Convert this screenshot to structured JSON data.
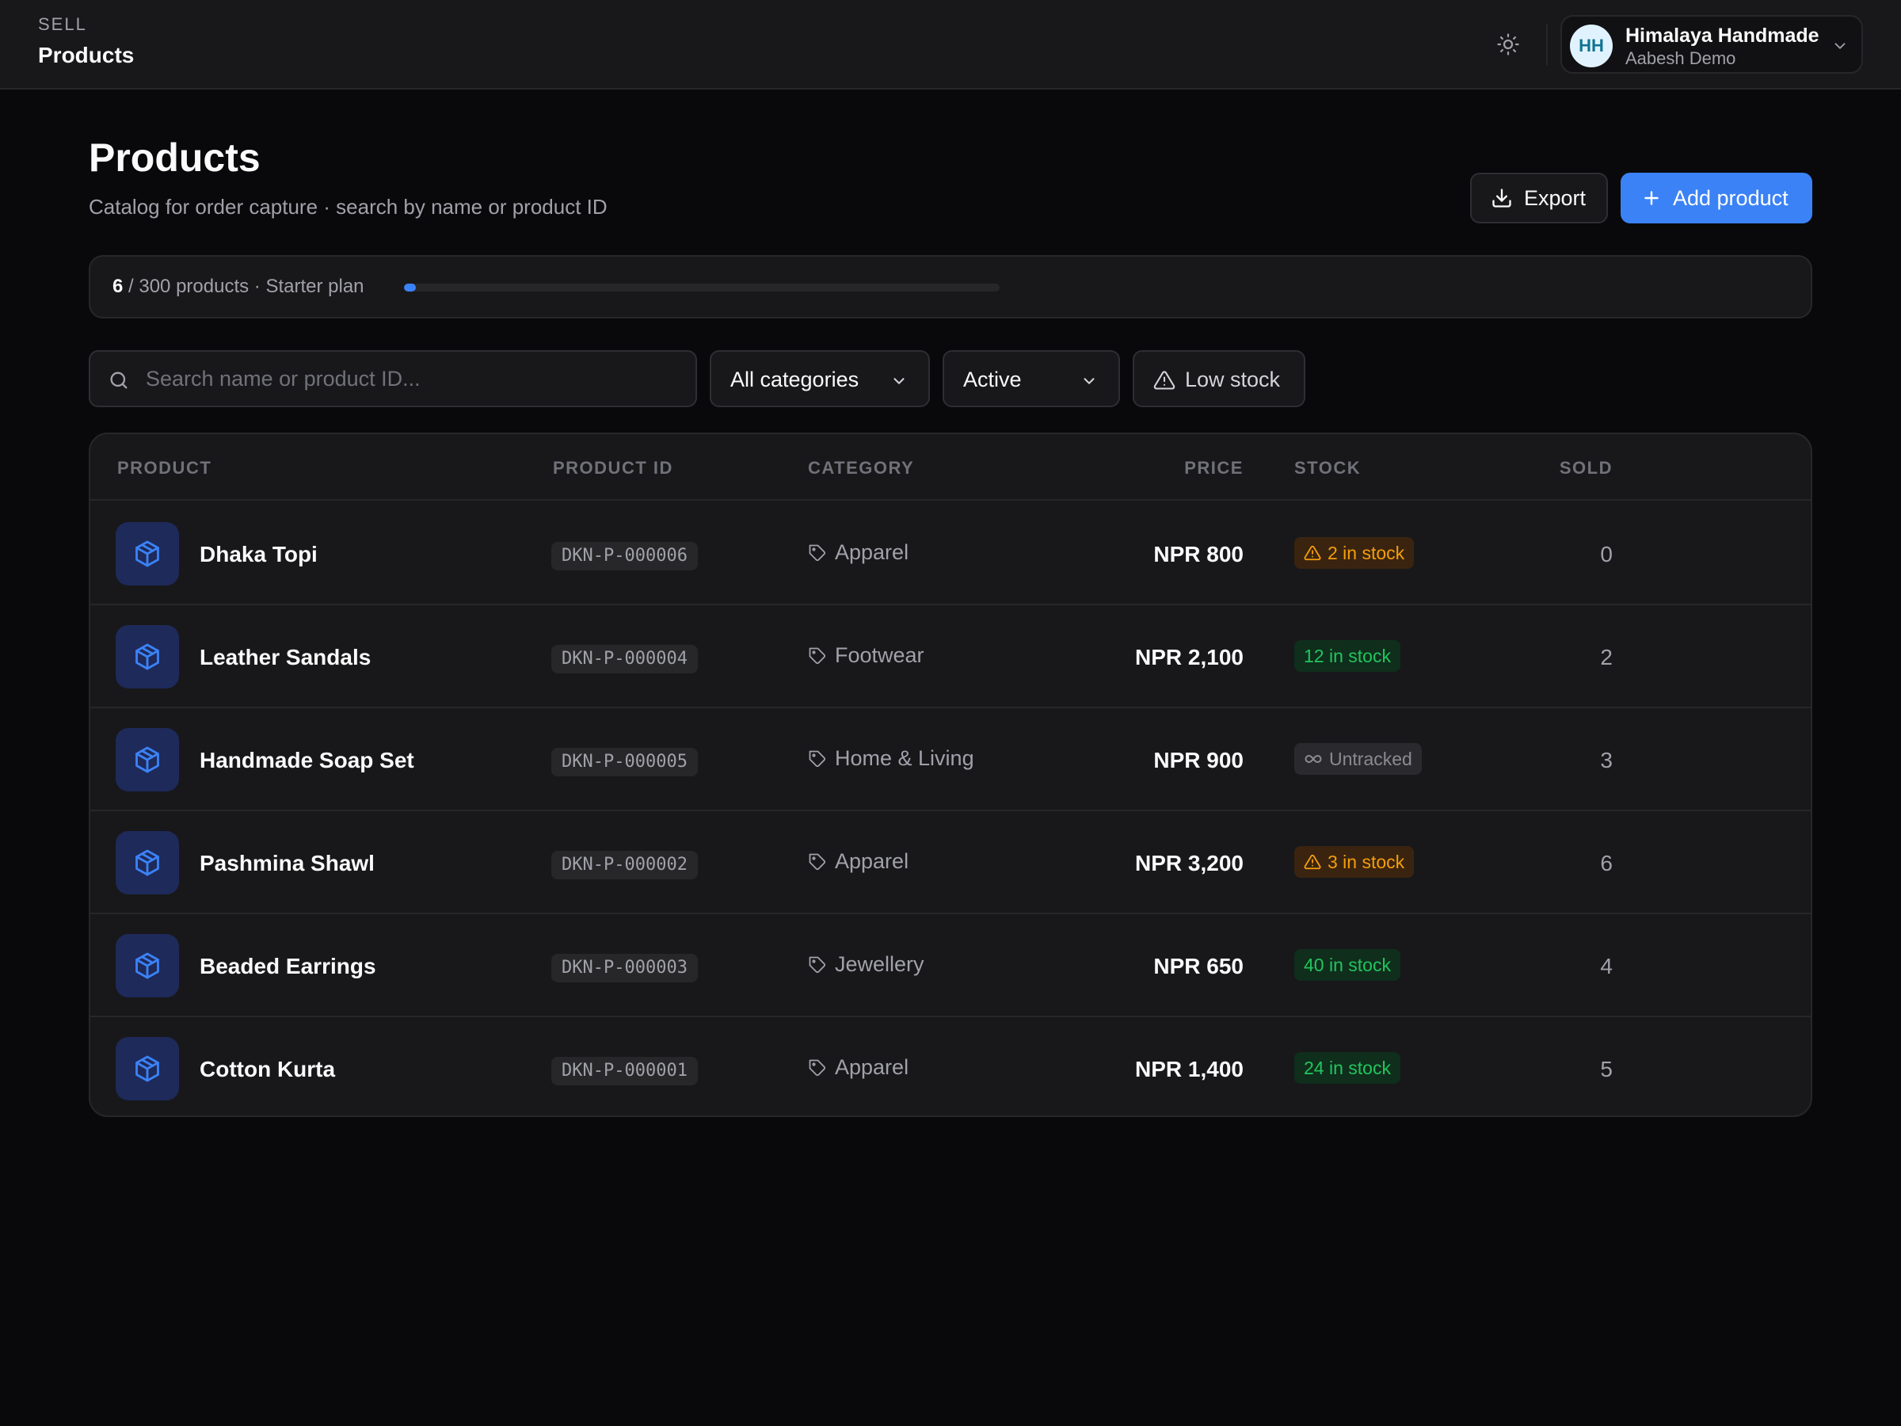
{
  "topbar": {
    "section": "SELL",
    "breadcrumb": "Products",
    "account": {
      "initials": "HH",
      "org_name": "Himalaya Handmade",
      "user_name": "Aabesh Demo"
    }
  },
  "header": {
    "title": "Products",
    "subtitle": "Catalog for order capture · search by name or product ID",
    "export_label": "Export",
    "add_label": "Add product"
  },
  "plan": {
    "used": "6",
    "rest": " / 300 products · Starter plan",
    "usage_fraction": 0.02
  },
  "filters": {
    "search_placeholder": "Search name or product ID...",
    "category_value": "All categories",
    "status_value": "Active",
    "low_stock_label": "Low stock"
  },
  "table": {
    "headers": {
      "product": "PRODUCT",
      "product_id": "PRODUCT ID",
      "category": "CATEGORY",
      "price": "PRICE",
      "stock": "STOCK",
      "sold": "SOLD"
    },
    "rows": [
      {
        "name": "Dhaka Topi",
        "id": "DKN-P-000006",
        "category": "Apparel",
        "price": "NPR 800",
        "stock": "2 in stock",
        "stock_status": "low",
        "sold": "0"
      },
      {
        "name": "Leather Sandals",
        "id": "DKN-P-000004",
        "category": "Footwear",
        "price": "NPR 2,100",
        "stock": "12 in stock",
        "stock_status": "ok",
        "sold": "2"
      },
      {
        "name": "Handmade Soap Set",
        "id": "DKN-P-000005",
        "category": "Home & Living",
        "price": "NPR 900",
        "stock": "Untracked",
        "stock_status": "untracked",
        "sold": "3"
      },
      {
        "name": "Pashmina Shawl",
        "id": "DKN-P-000002",
        "category": "Apparel",
        "price": "NPR 3,200",
        "stock": "3 in stock",
        "stock_status": "low",
        "sold": "6"
      },
      {
        "name": "Beaded Earrings",
        "id": "DKN-P-000003",
        "category": "Jewellery",
        "price": "NPR 650",
        "stock": "40 in stock",
        "stock_status": "ok",
        "sold": "4"
      },
      {
        "name": "Cotton Kurta",
        "id": "DKN-P-000001",
        "category": "Apparel",
        "price": "NPR 1,400",
        "stock": "24 in stock",
        "stock_status": "ok",
        "sold": "5"
      }
    ]
  },
  "icons": {
    "theme": "sun-icon",
    "account_chevron": "chevron-down-icon",
    "export": "download-icon",
    "add": "plus-icon",
    "search": "search-icon",
    "low_stock": "warning-triangle-icon",
    "product": "package-icon",
    "category": "tag-icon",
    "untracked": "infinity-icon"
  },
  "colors": {
    "accent": "#3b82f6",
    "background": "#09090b",
    "surface": "#18181b",
    "low_stock": "#f59e0b",
    "in_stock": "#22c55e",
    "untracked": "#8a8a93"
  }
}
